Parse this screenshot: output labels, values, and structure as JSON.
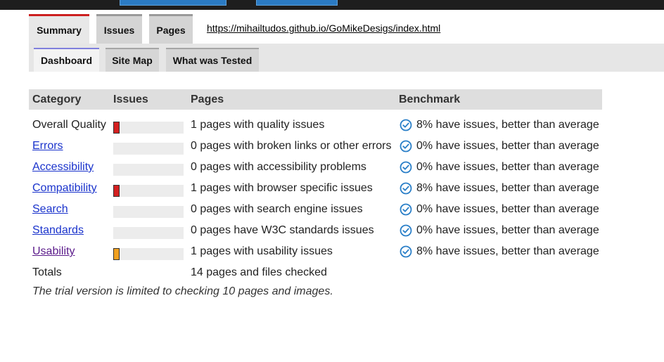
{
  "tabs_primary": [
    {
      "label": "Summary",
      "active": true
    },
    {
      "label": "Issues",
      "active": false
    },
    {
      "label": "Pages",
      "active": false
    }
  ],
  "url": "https://mihailtudos.github.io/GoMikeDesigs/index.html",
  "tabs_secondary": [
    {
      "label": "Dashboard",
      "active": true
    },
    {
      "label": "Site Map",
      "active": false
    },
    {
      "label": "What was Tested",
      "active": false
    }
  ],
  "table": {
    "headers": {
      "category": "Category",
      "issues": "Issues",
      "pages": "Pages",
      "benchmark": "Benchmark"
    },
    "rows": [
      {
        "category": "Overall Quality",
        "link": false,
        "issue_level": 0.05,
        "bar_color": "#d42020",
        "pages": "1 pages with quality issues",
        "benchmark": "8% have issues, better than average"
      },
      {
        "category": "Errors",
        "link": true,
        "issue_level": 0,
        "bar_color": "",
        "pages": "0 pages with broken links or other errors",
        "benchmark": "0% have issues, better than average"
      },
      {
        "category": "Accessibility",
        "link": true,
        "issue_level": 0,
        "bar_color": "",
        "pages": "0 pages with accessibility problems",
        "benchmark": "0% have issues, better than average"
      },
      {
        "category": "Compatibility",
        "link": true,
        "issue_level": 0.05,
        "bar_color": "#d42020",
        "pages": "1 pages with browser specific issues",
        "benchmark": "8% have issues, better than average"
      },
      {
        "category": "Search",
        "link": true,
        "issue_level": 0,
        "bar_color": "",
        "pages": "0 pages with search engine issues",
        "benchmark": "0% have issues, better than average"
      },
      {
        "category": "Standards",
        "link": true,
        "issue_level": 0,
        "bar_color": "",
        "pages": "0 pages have W3C standards issues",
        "benchmark": "0% have issues, better than average"
      },
      {
        "category": "Usability",
        "link": true,
        "visited": true,
        "issue_level": 0.05,
        "bar_color": "#f0a020",
        "pages": "1 pages with usability issues",
        "benchmark": "8% have issues, better than average"
      }
    ],
    "totals_label": "Totals",
    "totals_pages": "14 pages and files checked",
    "note": "The trial version is limited to checking 10 pages and images."
  },
  "benchmark_icon": "check-circle-icon",
  "colors": {
    "check_icon": "#2a7fc8",
    "link": "#1a33cc",
    "visited_link": "#5a1a8a",
    "active_tab_accent": "#cc1f1f"
  }
}
